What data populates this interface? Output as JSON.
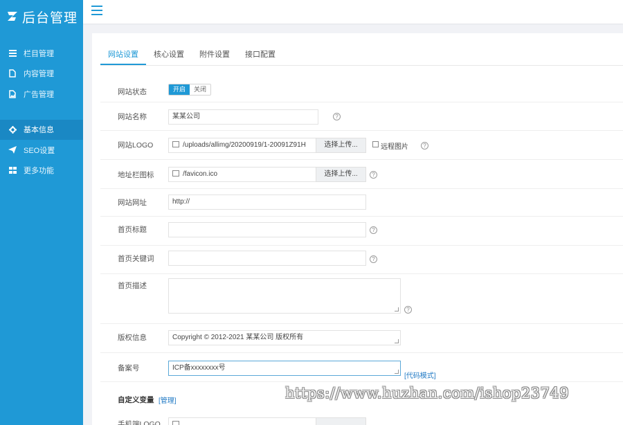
{
  "app": {
    "logo_text": "后台管理"
  },
  "colors": {
    "sidebar": "#1f99d6",
    "sidebar_active": "#1a88c4",
    "accent": "#1f99d6"
  },
  "sidebar": {
    "items": [
      {
        "label": "栏目管理",
        "icon": "list-icon"
      },
      {
        "label": "内容管理",
        "icon": "file-icon"
      },
      {
        "label": "广告管理",
        "icon": "image-icon"
      },
      {
        "label": "基本信息",
        "icon": "gear-icon"
      },
      {
        "label": "SEO设置",
        "icon": "paper-plane-icon"
      },
      {
        "label": "更多功能",
        "icon": "grid-icon"
      }
    ]
  },
  "tabs": [
    "网站设置",
    "核心设置",
    "附件设置",
    "接口配置"
  ],
  "form": {
    "site_status": {
      "label": "网站状态",
      "on": "开启",
      "off": "关闭"
    },
    "site_name": {
      "label": "网站名称",
      "value": "某某公司"
    },
    "site_logo": {
      "label": "网站LOGO",
      "value": "/uploads/allimg/20200919/1-20091Z91H",
      "upload": "选择上传...",
      "remote": "远程图片"
    },
    "favicon": {
      "label": "地址栏图标",
      "value": "/favicon.ico",
      "upload": "选择上传..."
    },
    "site_url": {
      "label": "网站网址",
      "value": "http://"
    },
    "home_title": {
      "label": "首页标题",
      "value": ""
    },
    "home_keywords": {
      "label": "首页关键词",
      "value": ""
    },
    "home_desc": {
      "label": "首页描述",
      "value": ""
    },
    "copyright": {
      "label": "版权信息",
      "value": "Copyright © 2012-2021 某某公司 版权所有"
    },
    "icp": {
      "label": "备案号",
      "value": "ICP备xxxxxxxx号",
      "code_mode": "[代码模式]"
    },
    "custom_vars": {
      "label": "自定义变量",
      "manage": "[管理]"
    },
    "mobile_logo": {
      "label": "手机端LOGO"
    }
  },
  "watermark": "https://www.huzhan.com/ishop23749"
}
